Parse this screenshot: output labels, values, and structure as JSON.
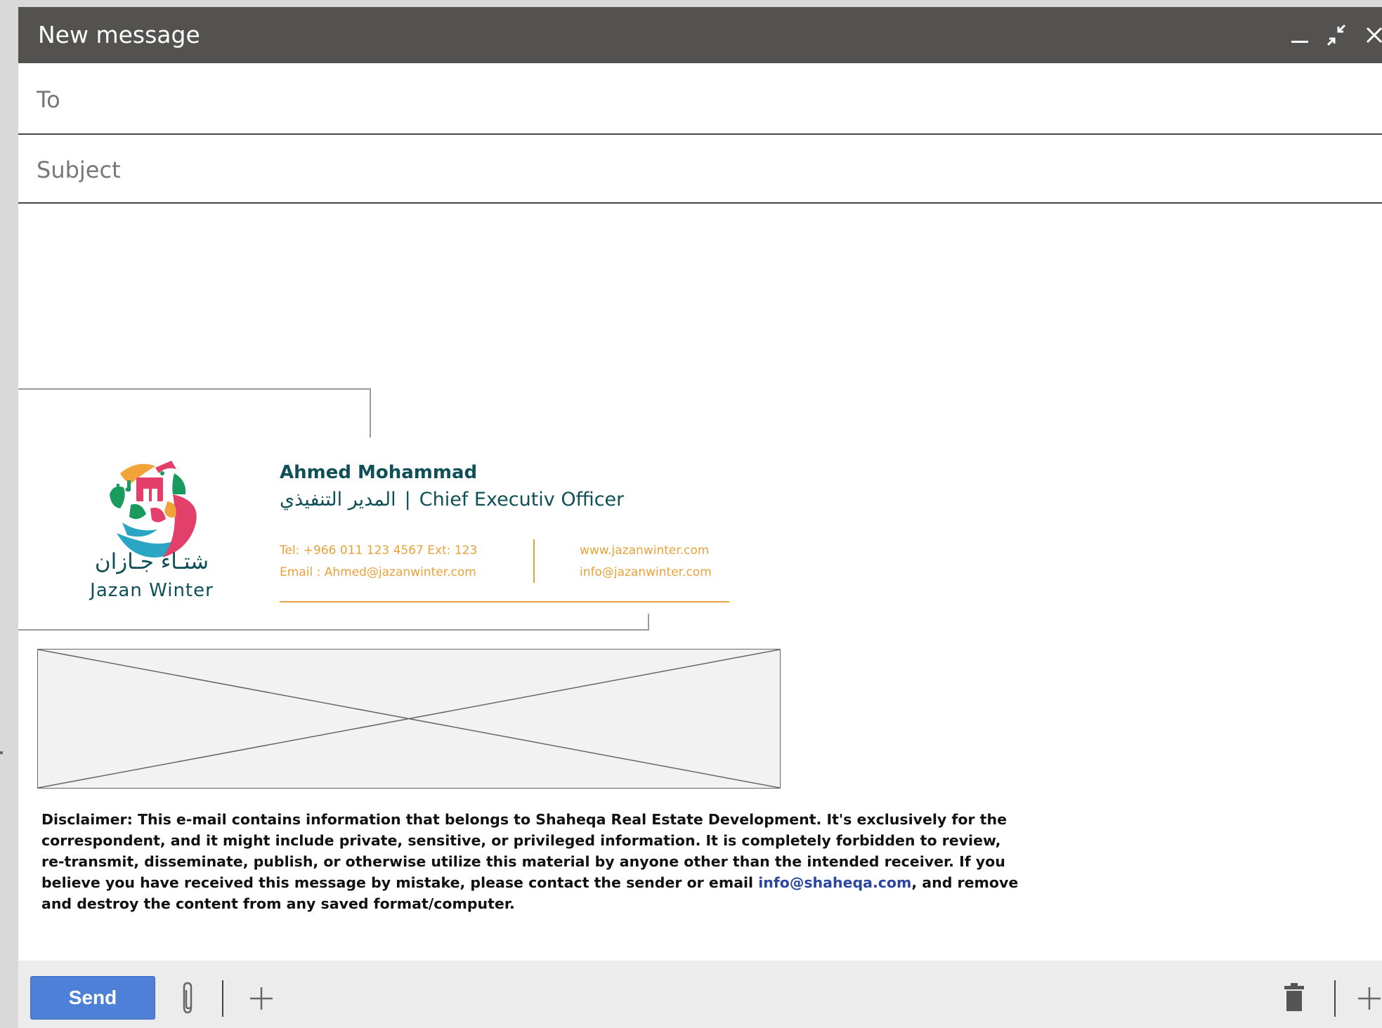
{
  "window": {
    "title": "New message",
    "minimize_icon": "minimize-icon",
    "exit_fullscreen_icon": "exit-fullscreen-icon",
    "close_icon": "close-icon"
  },
  "fields": {
    "to_placeholder": "To",
    "subject_placeholder": "Subject"
  },
  "signature": {
    "logo_ar": "شتـاء جـازان",
    "logo_en": "Jazan Winter",
    "name": "Ahmed Mohammad",
    "title_ar": "المدير التنفيذي",
    "title_separator": "|",
    "title_en": "Chief Executiv Officer",
    "tel": "Tel: +966 011 123 4567  Ext: 123",
    "email": "Email : Ahmed@jazanwinter.com",
    "website": "www.jazanwinter.com",
    "info_email": "info@jazanwinter.com",
    "accent_color": "#e8a23a",
    "name_color": "#0e4f58"
  },
  "disclaimer": {
    "text_before": "Disclaimer: This e-mail contains information that belongs to Shaheqa Real Estate Development. It's exclusively for the correspondent, and it might include private, sensitive, or privileged information. It is completely forbidden to review, re-transmit, disseminate, publish, or otherwise utilize this material by anyone other than the intended receiver. If you believe you have received this message by mistake, please contact the sender or email ",
    "email": "info@shaheqa.com",
    "text_after": ", and remove and destroy the content from any saved format/computer."
  },
  "toolbar": {
    "send_label": "Send",
    "attach_icon": "paperclip-icon",
    "add_icon": "plus-icon",
    "trash_icon": "trash-icon",
    "more_icon": "plus-icon"
  }
}
